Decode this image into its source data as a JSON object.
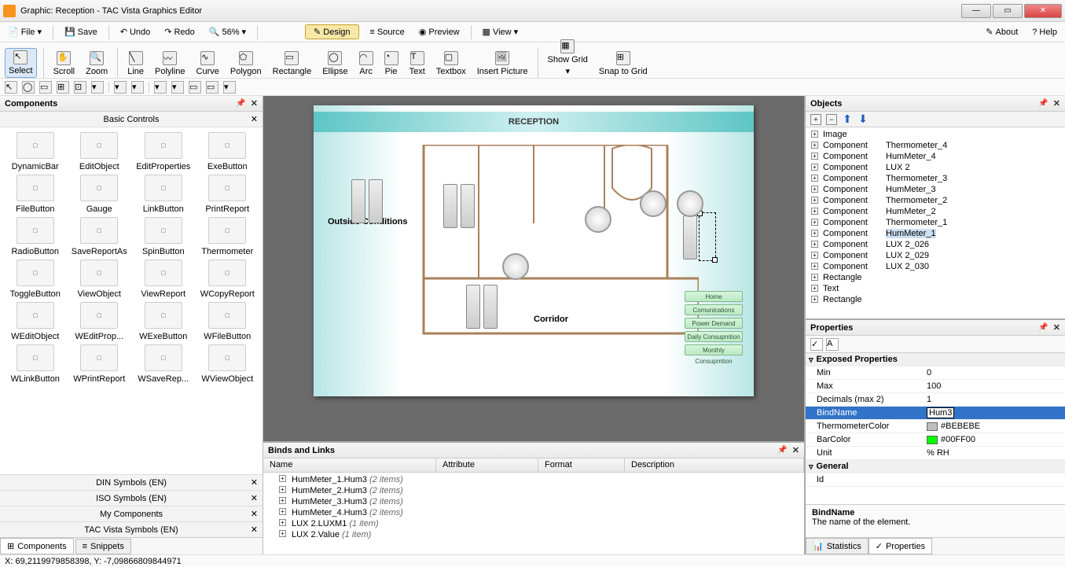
{
  "title": "Graphic: Reception - TAC Vista Graphics Editor",
  "menubar": {
    "file": "File",
    "save": "Save",
    "undo": "Undo",
    "redo": "Redo",
    "zoom": "56%",
    "design": "Design",
    "source": "Source",
    "preview": "Preview",
    "view": "View",
    "about": "About",
    "help": "Help"
  },
  "toolbar": {
    "select": "Select",
    "scroll": "Scroll",
    "zoom": "Zoom",
    "line": "Line",
    "polyline": "Polyline",
    "curve": "Curve",
    "polygon": "Polygon",
    "rectangle": "Rectangle",
    "ellipse": "Ellipse",
    "arc": "Arc",
    "pie": "Pie",
    "text": "Text",
    "textbox": "Textbox",
    "insertpic": "Insert Picture",
    "showgrid": "Show Grid",
    "snapgrid": "Snap to Grid"
  },
  "components": {
    "title": "Components",
    "basic": "Basic Controls",
    "items": [
      [
        "DynamicBar",
        "EditObject",
        "EditProperties",
        "ExeButton"
      ],
      [
        "FileButton",
        "Gauge",
        "LinkButton",
        "PrintReport"
      ],
      [
        "RadioButton",
        "SaveReportAs",
        "SpinButton",
        "Thermometer"
      ],
      [
        "ToggleButton",
        "ViewObject",
        "ViewReport",
        "WCopyReport"
      ],
      [
        "WEditObject",
        "WEditProp...",
        "WExeButton",
        "WFileButton"
      ],
      [
        "WLinkButton",
        "WPrintReport",
        "WSaveRep...",
        "WViewObject"
      ]
    ],
    "symbol_groups": [
      "DIN Symbols (EN)",
      "ISO Symbols (EN)",
      "My Components",
      "TAC Vista Symbols (EN)"
    ],
    "tabs": [
      "Components",
      "Snippets"
    ]
  },
  "canvas": {
    "title": "RECEPTION",
    "outside": "Outside Conditions",
    "corridor": "Corridor",
    "nav": [
      "Home",
      "Comunications",
      "Power Demand",
      "Daily Consupmtion",
      "Monthly Consupmtion"
    ]
  },
  "binds": {
    "title": "Binds and Links",
    "cols": [
      "Name",
      "Attribute",
      "Format",
      "Description"
    ],
    "items": [
      {
        "n": "HumMeter_1.Hum3",
        "c": "(2 items)"
      },
      {
        "n": "HumMeter_2.Hum3",
        "c": "(2 items)"
      },
      {
        "n": "HumMeter_3.Hum3",
        "c": "(2 items)"
      },
      {
        "n": "HumMeter_4.Hum3",
        "c": "(2 items)"
      },
      {
        "n": "LUX 2.LUXM1",
        "c": "(1 item)"
      },
      {
        "n": "LUX 2.Value",
        "c": "(1 item)"
      }
    ]
  },
  "objects": {
    "title": "Objects",
    "rows": [
      {
        "t": "Image",
        "n": ""
      },
      {
        "t": "Component",
        "n": "Thermometer_4"
      },
      {
        "t": "Component",
        "n": "HumMeter_4"
      },
      {
        "t": "Component",
        "n": "LUX 2"
      },
      {
        "t": "Component",
        "n": "Thermometer_3"
      },
      {
        "t": "Component",
        "n": "HumMeter_3"
      },
      {
        "t": "Component",
        "n": "Thermometer_2"
      },
      {
        "t": "Component",
        "n": "HumMeter_2"
      },
      {
        "t": "Component",
        "n": "Thermometer_1"
      },
      {
        "t": "Component",
        "n": "HumMeter_1",
        "sel": true
      },
      {
        "t": "Component",
        "n": "LUX 2_026"
      },
      {
        "t": "Component",
        "n": "LUX 2_029"
      },
      {
        "t": "Component",
        "n": "LUX 2_030"
      },
      {
        "t": "Rectangle",
        "n": ""
      },
      {
        "t": "Text",
        "n": ""
      },
      {
        "t": "Rectangle",
        "n": ""
      }
    ]
  },
  "properties": {
    "title": "Properties",
    "groups": {
      "exposed": "Exposed Properties",
      "general": "General"
    },
    "rows": [
      {
        "n": "Min",
        "v": "0"
      },
      {
        "n": "Max",
        "v": "100"
      },
      {
        "n": "Decimals (max 2)",
        "v": "1"
      },
      {
        "n": "BindName",
        "v": "Hum3",
        "sel": true
      },
      {
        "n": "ThermometerColor",
        "v": "#BEBEBE",
        "swatch": "#BEBEBE"
      },
      {
        "n": "BarColor",
        "v": "#00FF00",
        "swatch": "#00FF00"
      },
      {
        "n": "Unit",
        "v": "% RH"
      }
    ],
    "general_rows": [
      {
        "n": "Id",
        "v": ""
      }
    ],
    "desc": {
      "name": "BindName",
      "text": "The name of the element."
    },
    "tabs": [
      "Statistics",
      "Properties"
    ]
  },
  "status": "X: 69,2119979858398, Y: -7,09866809844971"
}
